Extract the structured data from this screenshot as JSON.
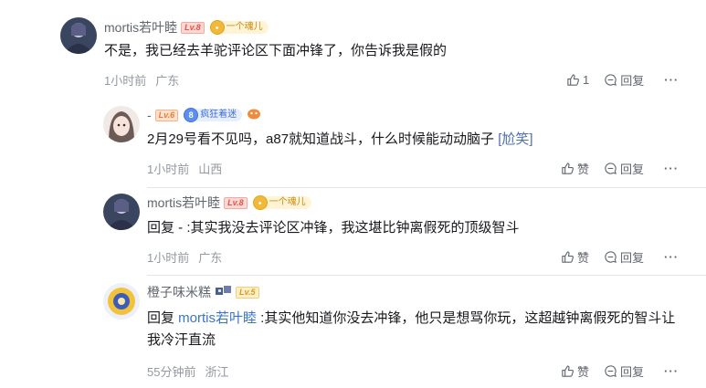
{
  "comments": [
    {
      "user": "mortis若叶睦",
      "level": "Lv.8",
      "fan_badge": "一个魂儿",
      "text": "不是，我已经去羊驼评论区下面冲锋了，你告诉我是假的",
      "time": "1小时前",
      "location": "广东",
      "like_label": "1",
      "reply_label": "回复",
      "more_label": "···"
    },
    {
      "user": "-",
      "level": "Lv.6",
      "fan_badge_icon": "8",
      "fan_badge": "疯狂着迷",
      "text_main": "2月29号看不见吗，a87就知道战斗，什么时候能动动脑子 ",
      "text_emote": "[尬笑]",
      "time": "1小时前",
      "location": "山西",
      "like_label": "赞",
      "reply_label": "回复",
      "more_label": "···"
    },
    {
      "user": "mortis若叶睦",
      "level": "Lv.8",
      "fan_badge": "一个魂儿",
      "text": "回复 - :其实我没去评论区冲锋，我这堪比钟离假死的顶级智斗",
      "time": "1小时前",
      "location": "广东",
      "like_label": "赞",
      "reply_label": "回复",
      "more_label": "···"
    },
    {
      "user": "橙子味米糕",
      "level": "Lv.5",
      "text_prefix": "回复 ",
      "mention": "mortis若叶睦",
      "text_line1": " :其实他知道你没去冲锋，他只是想骂你玩，这超越钟离假死的智斗让",
      "text_line2": "我冷汗直流",
      "time": "55分钟前",
      "location": "浙江",
      "like_label": "赞",
      "reply_label": "回复",
      "more_label": "···"
    }
  ],
  "colors": {
    "name": "#61666d",
    "text": "#18191c",
    "meta": "#9499a0",
    "mention": "#3a74c9",
    "divider": "#e3e5e7"
  }
}
